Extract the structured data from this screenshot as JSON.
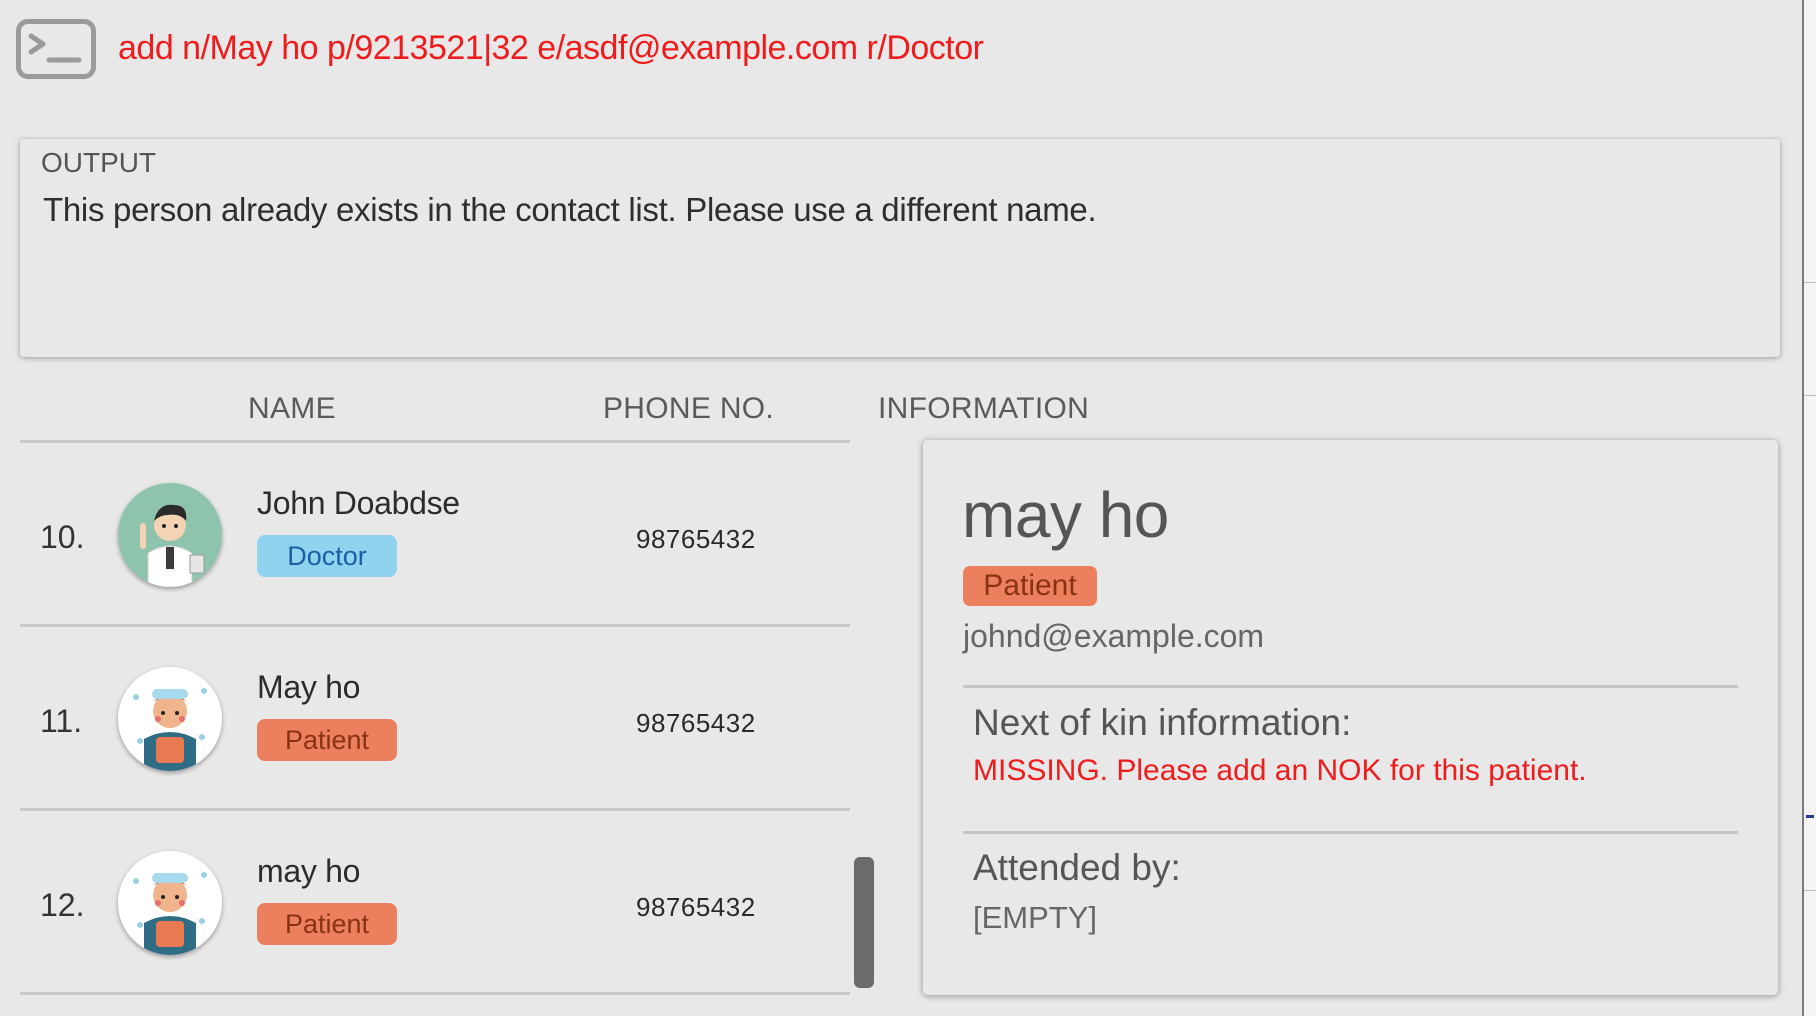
{
  "command": {
    "icon": "terminal-icon",
    "value": "add n/May ho p/9213521|32 e/asdf@example.com r/Doctor",
    "text_color": "#ee1c1c"
  },
  "output": {
    "label": "OUTPUT",
    "message": "This person already exists in the contact list. Please use a different name."
  },
  "list": {
    "headers": {
      "name": "NAME",
      "phone": "PHONE NO."
    },
    "rows": [
      {
        "index": "10.",
        "name": "John Doabdse",
        "tag": "Doctor",
        "phone": "98765432",
        "avatar": "doctor-avatar-icon"
      },
      {
        "index": "11.",
        "name": "May ho",
        "tag": "Patient",
        "phone": "98765432",
        "avatar": "patient-avatar-icon"
      },
      {
        "index": "12.",
        "name": "may ho",
        "tag": "Patient",
        "phone": "98765432",
        "avatar": "patient-avatar-icon"
      }
    ]
  },
  "info": {
    "header": "INFORMATION",
    "name": "may ho",
    "tag": "Patient",
    "email": "johnd@example.com",
    "nok_title": "Next of kin information:",
    "nok_value": "MISSING. Please add an NOK for this patient.",
    "attended_title": "Attended by:",
    "attended_value": "[EMPTY]"
  },
  "colors": {
    "doctor_tag_bg": "#8fd3ef",
    "patient_tag_bg": "#ec7f5e",
    "error_text": "#ee1c1c",
    "background": "#e8e8e8"
  }
}
